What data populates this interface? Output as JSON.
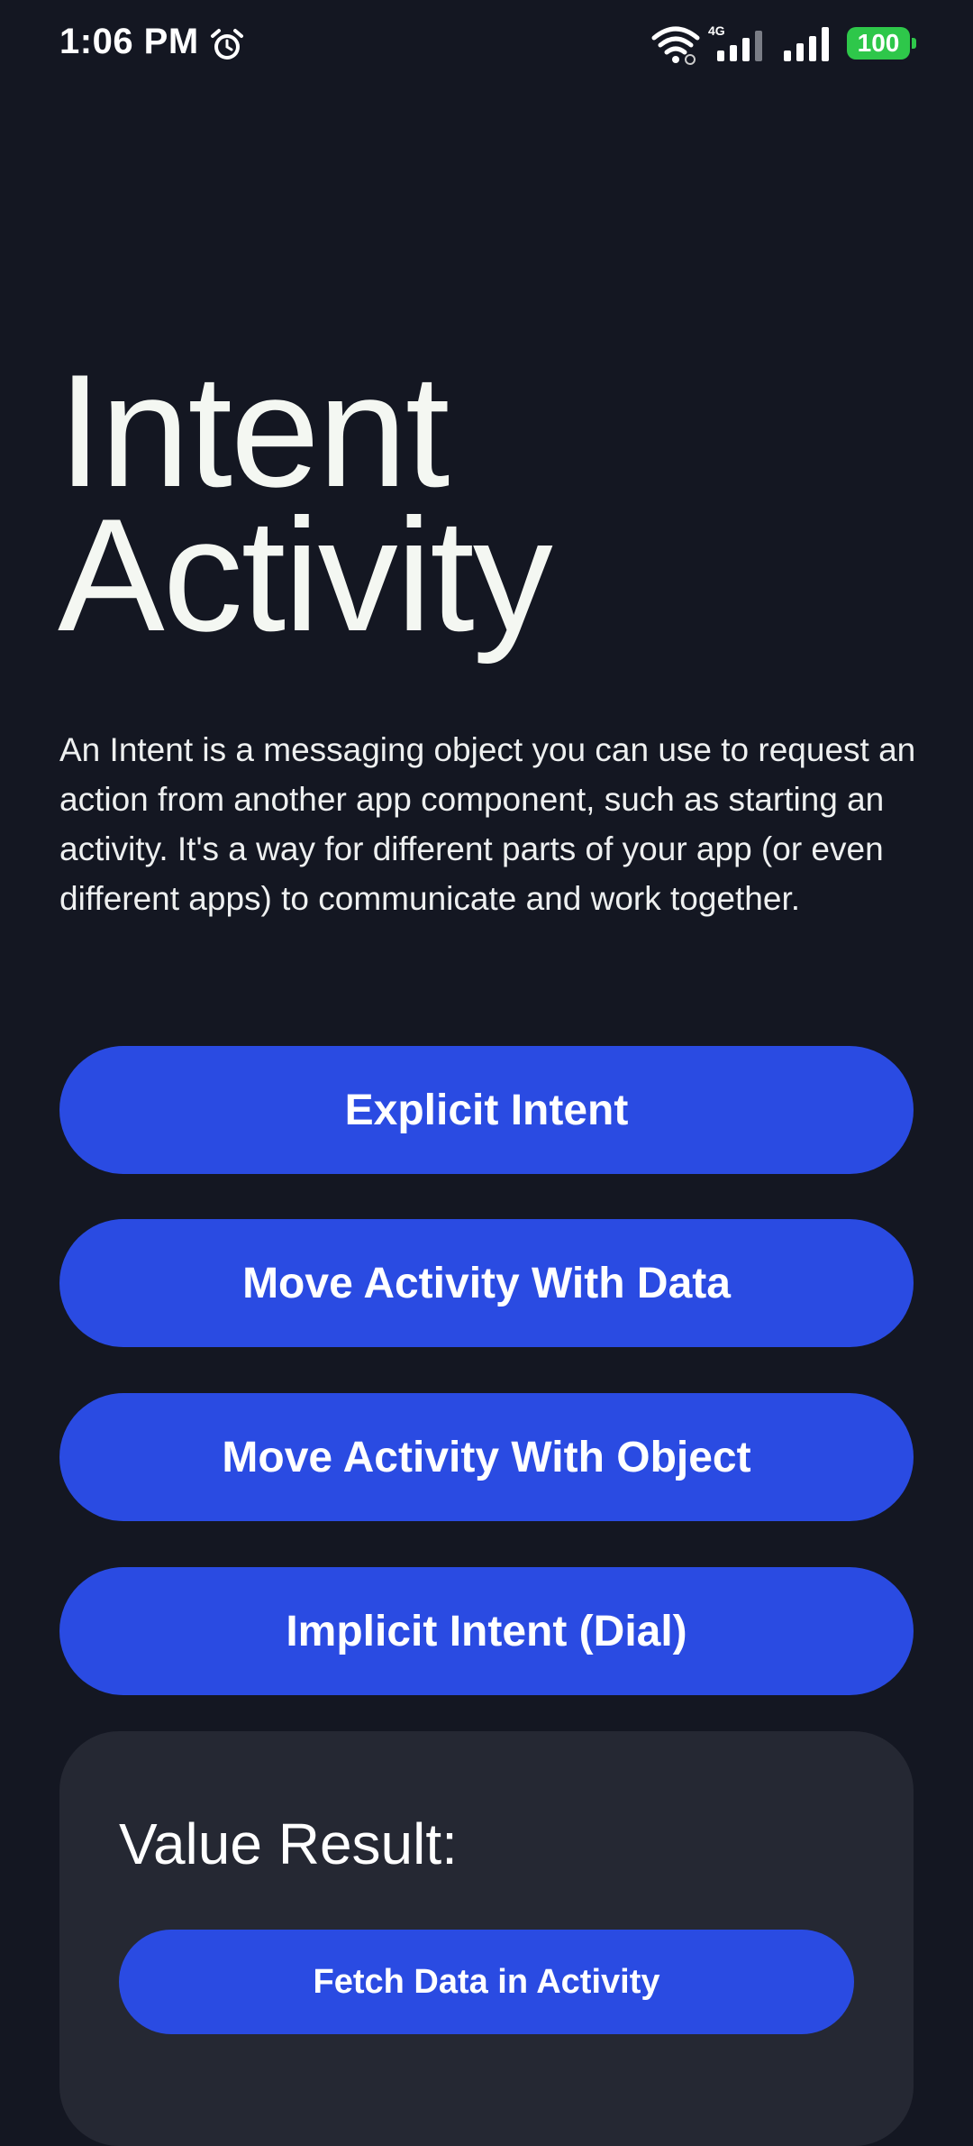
{
  "status_bar": {
    "time": "1:06 PM",
    "alarm_icon": "alarm-clock-icon",
    "wifi_icon": "wifi-icon",
    "network_type": "4G",
    "battery_level": "100",
    "battery_color": "#2ec74a"
  },
  "main": {
    "title_line1": "Intent",
    "title_line2": "Activity",
    "description": "An Intent is a messaging object you can use to request an action from another app component, such as starting an activity. It's a way for different parts of your app (or even different apps) to communicate and work together."
  },
  "buttons": {
    "explicit_intent": "Explicit Intent",
    "move_with_data": "Move Activity With Data",
    "move_with_object": "Move Activity With Object",
    "implicit_intent_dial": "Implicit Intent (Dial)"
  },
  "result_card": {
    "label": "Value Result:",
    "fetch_button": "Fetch Data in Activity"
  },
  "colors": {
    "background": "#141722",
    "button": "#2a4be2",
    "card": "#252833"
  }
}
